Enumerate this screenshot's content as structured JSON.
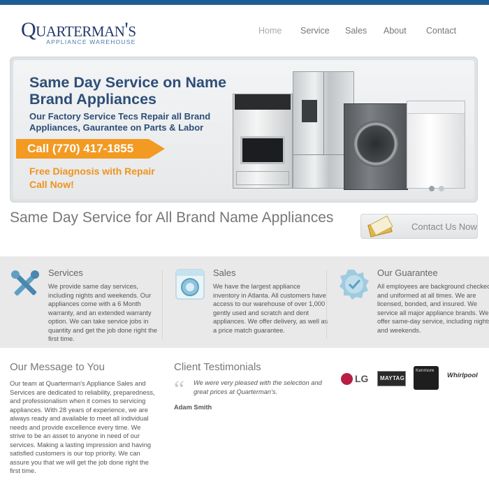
{
  "header": {
    "logo_main": "Quarterman's",
    "logo_sub": "APPLIANCE WAREHOUSE",
    "nav": [
      "Home",
      "Service",
      "Sales",
      "About",
      "Contact"
    ]
  },
  "banner": {
    "title": "Same Day Service on Name Brand Appliances",
    "subtitle": "Our Factory Service Tecs Repair all Brand Appliances, Gaurantee on Parts & Labor",
    "phone": "Call (770) 417-1855",
    "free_line1": "Free Diagnosis with Repair",
    "free_line2": "Call Now!"
  },
  "tagline": "Same Day Service for All Brand Name Appliances",
  "contact_button": "Contact Us Now",
  "features": [
    {
      "title": "Services",
      "text": "We provide same day services, including nights and weekends. Our appliances come with a 6 Month warranty, and an extended warranty option. We can take service jobs in quantity and get the job done right the first time."
    },
    {
      "title": "Sales",
      "text": "We have the largest appliance inventory in Atlanta. All customers have access to our warehouse of over 1,000 gently used and scratch and dent appliances. We offer delivery, as well as a price match guarantee."
    },
    {
      "title": "Our Guarantee",
      "text": "All employees are background checked and uniformed at all times. We are licensed, bonded, and insured. We service all major appliance brands. We offer same-day service, including nights and weekends."
    }
  ],
  "message": {
    "title": "Our Message to You",
    "text": "Our team at Quarterman's Appliance Sales and Services are dedicated to reliability, preparedness, and professionalism when it comes to servicing appliances. With 28 years of experience, we are always ready and available to meet all individual needs and provide excellence every time. We strive to be an asset to anyone in need of our services. Making a lasting impression and having satisfied customers is our top priority. We can assure you that we will get the job done right the first time."
  },
  "testimonials": {
    "title": "Client Testimonials",
    "quote": "We were very pleased with the selection and great prices at Quarterman's.",
    "author": "Adam Smith"
  },
  "brands": {
    "lg": "LG",
    "maytag": "MAYTAG",
    "kenmore": "Kenmore",
    "whirlpool": "Whirlpool"
  },
  "colors": {
    "topbar": "#1d5d96",
    "banner_text": "#2d4e78",
    "accent_orange": "#f29a22"
  },
  "slider_dots": 2
}
